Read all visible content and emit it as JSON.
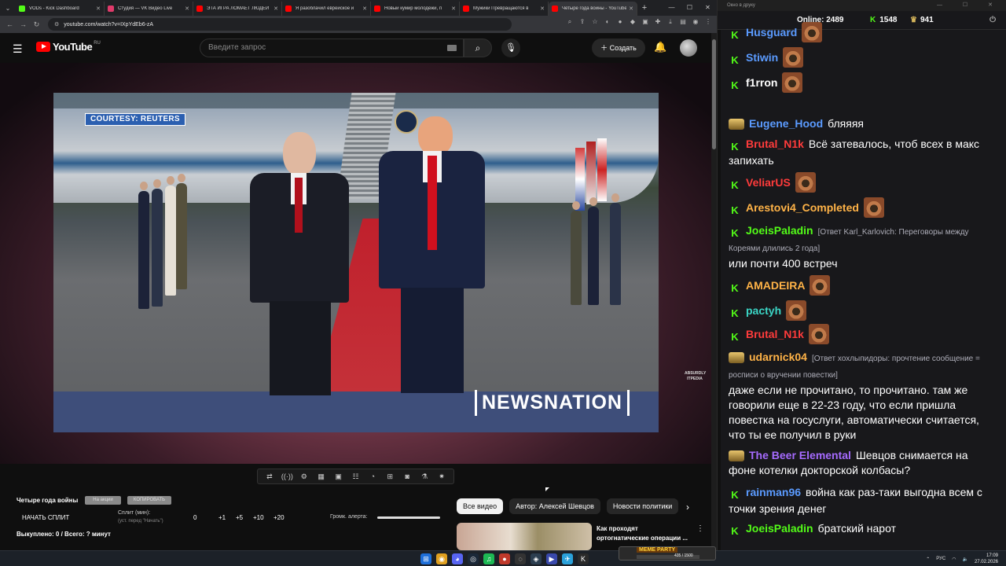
{
  "browser": {
    "tabs": [
      {
        "title": "VODs - Kick Dashboard",
        "color": "#53fc18"
      },
      {
        "title": "Студия — VK Видео Live",
        "color": "#e03a6a"
      },
      {
        "title": "ЭТА ИГРА ЛОМАЕТ ЛЮДЕЙ",
        "color": "#ff0000"
      },
      {
        "title": "Я разоблачил еврейское и",
        "color": "#ff0000"
      },
      {
        "title": "Новый кумир молодежи, п",
        "color": "#ff0000"
      },
      {
        "title": "Мужики Превращаются в",
        "color": "#ff0000"
      },
      {
        "title": "Четыре года войны - YouTube",
        "color": "#ff0000"
      }
    ],
    "new_tab": "+",
    "url": "youtube.com/watch?v=IXpYdEb6-zA"
  },
  "youtube": {
    "logo_text": "YouTube",
    "logo_region": "RU",
    "search_placeholder": "Введите запрос",
    "create_label": "Создать",
    "video_overlay": {
      "courtesy": "COURTESY: REUTERS",
      "network": "NEWSNATION",
      "channel_mark": "ABSURDLY ITPEDIA"
    }
  },
  "split_panel": {
    "title": "Четыре года войны",
    "chip_a": "На акции",
    "chip_b": "КОПИРОВАТЬ",
    "start_split": "НАЧАТЬ СПЛИТ",
    "split_label": "Сплит (мин):",
    "split_sub": "(уст. перед \"Начать\")",
    "split_value": "0",
    "increments": [
      "+1",
      "+5",
      "+10",
      "+20"
    ],
    "alert_label": "Громк. алерта:",
    "alert_volume": 1.0,
    "progress": "Выкуплено: 0 / Всего: ? минут"
  },
  "related": {
    "chips": [
      "Все видео",
      "Автор: Алексей Шевцов",
      "Новости политики"
    ],
    "video_title": "Как проходят ортогнатические операции ..."
  },
  "chat": {
    "window_title": "Окно в друку",
    "online_label": "Online:",
    "online_count": "2489",
    "followers": "1548",
    "viewers": "941",
    "messages": [
      {
        "user": "Husguard",
        "color": "#5b9bff",
        "badge": "kick",
        "text": "",
        "reply": "",
        "emote": true
      },
      {
        "user": "Stiwin",
        "color": "#5b9bff",
        "badge": "kick",
        "text": "",
        "reply": "",
        "emote": true
      },
      {
        "user": "f1rron",
        "color": "#ffffff",
        "badge": "kick",
        "text": "",
        "reply": "",
        "emote": true
      },
      {
        "user": "Eugene_Hood",
        "color": "#5b9bff",
        "badge": "vip",
        "text": "бляяяя",
        "reply": "",
        "emote": false
      },
      {
        "user": "Brutal_N1k",
        "color": "#ff3b3b",
        "badge": "kick",
        "text": "Всё затевалось, чтоб всех в макс запихать",
        "reply": "",
        "emote": false
      },
      {
        "user": "VeliarUS",
        "color": "#ff3b3b",
        "badge": "kick",
        "text": "",
        "reply": "",
        "emote": true
      },
      {
        "user": "Arestovi4_Completed",
        "color": "#ffb347",
        "badge": "kick",
        "text": "",
        "reply": "",
        "emote": true
      },
      {
        "user": "JoeisPaladin",
        "color": "#53fc18",
        "badge": "kick",
        "text": "или почти 400 встреч",
        "reply": "[Ответ Karl_Karlovich: Переговоры между Кореями длились 2 года]",
        "emote": false
      },
      {
        "user": "AMADEIRA",
        "color": "#ffb347",
        "badge": "kick",
        "text": "",
        "reply": "",
        "emote": true
      },
      {
        "user": "pactyh",
        "color": "#3bd6c6",
        "badge": "kick",
        "text": "",
        "reply": "",
        "emote": true
      },
      {
        "user": "Brutal_N1k",
        "color": "#ff3b3b",
        "badge": "kick",
        "text": "",
        "reply": "",
        "emote": true
      },
      {
        "user": "udarnick04",
        "color": "#ffb347",
        "badge": "vip",
        "text": "даже если не прочитано, то прочитано. там же говорили еще в 22-23 году, что если пришла повестка на госуслуги, автоматически считается, что ты ее получил в руки",
        "reply": "[Ответ хохлыпидоры: прочтение сообщение = росписи о вручении повестки]",
        "emote": false
      },
      {
        "user": "The Beer Elemental",
        "color": "#a66bff",
        "badge": "vip",
        "text": "Шевцов снимается на фоне котелки докторской колбасы?",
        "reply": "",
        "emote": false
      },
      {
        "user": "rainman96",
        "color": "#5b9bff",
        "badge": "kick",
        "text": "война как раз-таки выгодна всем с точки зрения денег",
        "reply": "",
        "emote": false
      },
      {
        "user": "JoeisPaladin",
        "color": "#53fc18",
        "badge": "kick",
        "text": "братский нарот",
        "reply": "",
        "emote": false
      }
    ]
  },
  "taskbar": {
    "widget_title": "MEME PARTY",
    "widget_count": "435 / 1500",
    "lang": "РУС",
    "time": "17:09",
    "date": "27.02.2026"
  }
}
